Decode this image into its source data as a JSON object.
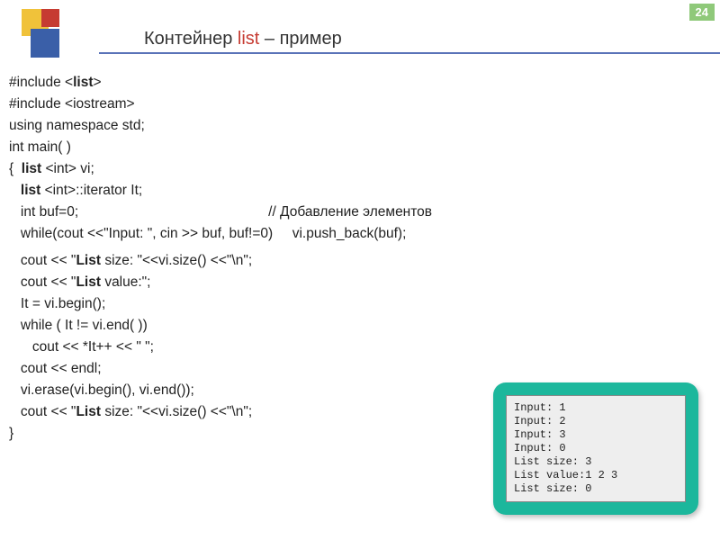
{
  "page_number": "24",
  "title": {
    "part1": "Контейнер ",
    "part2": "list",
    "part3": "  – пример"
  },
  "code": {
    "l01a": "#include <",
    "l01b": "list",
    "l01c": ">",
    "l02": "#include <iostream>",
    "l03": "using namespace std;",
    "l04": "int main( )",
    "l05a": "{  ",
    "l05b": "list ",
    "l05c": "<int> vi;",
    "l06a": "   ",
    "l06b": "list ",
    "l06c": "<int>::iterator It;",
    "l07": "   int buf=0;                                                 // Добавление элементов",
    "l08": "   while(cout <<\"Input: \", cin >> buf, buf!=0)     vi.push_back(buf);",
    "l09a": "   cout << \"",
    "l09b": "List ",
    "l09c": "size: \"<<vi.size() <<\"\\n\";",
    "l10a": "   cout << \"",
    "l10b": "List ",
    "l10c": "value:\";",
    "l11": "   It = vi.begin();",
    "l12": "   while ( It != vi.end( ))",
    "l13": "      cout << *It++ << \" \";",
    "l14": "   cout << endl;",
    "l15": "   vi.erase(vi.begin(), vi.end());",
    "l16a": "   cout << \"",
    "l16b": "List ",
    "l16c": "size: \"<<vi.size() <<\"\\n\";",
    "l17": "}"
  },
  "output": "Input: 1\nInput: 2\nInput: 3\nInput: 0\nList size: 3\nList value:1 2 3\nList size: 0"
}
